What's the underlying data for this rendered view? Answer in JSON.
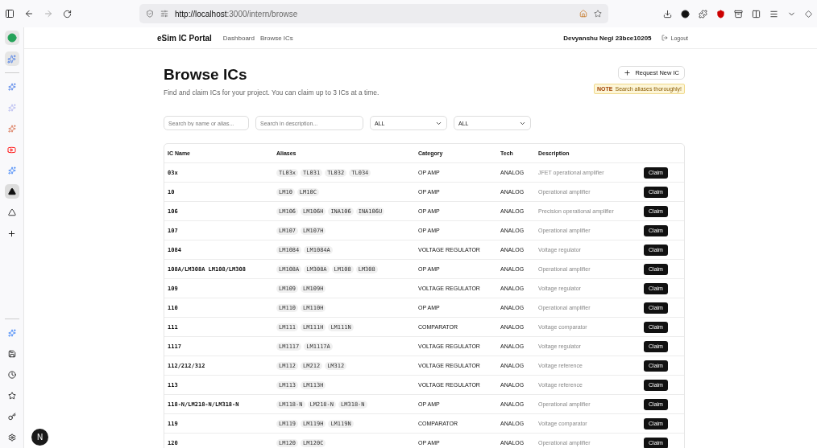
{
  "browser": {
    "url_host": "http://localhost",
    "url_rest": ":3000/intern/browse"
  },
  "nav": {
    "brand": "eSim IC Portal",
    "links": [
      "Dashboard",
      "Browse ICs"
    ],
    "user": "Devyanshu Negi 23bce10205",
    "logout": "Logout"
  },
  "header": {
    "title": "Browse ICs",
    "subtitle": "Find and claim ICs for your project. You can claim up to 3 ICs at a time.",
    "request_button": "Request New IC",
    "note_label": "NOTE",
    "note_text": "Search aliases thoroughly!"
  },
  "filters": {
    "name_search": {
      "placeholder": "Search by name or alias..."
    },
    "description_search": {
      "placeholder": "Search in description..."
    },
    "category_select": "ALL",
    "tech_select": "ALL"
  },
  "table": {
    "columns": [
      "IC Name",
      "Aliases",
      "Category",
      "Tech",
      "Description"
    ],
    "rows": [
      {
        "name": "03x",
        "aliases": [
          "TL03x",
          "TL031",
          "TL032",
          "TL034"
        ],
        "category": "OP AMP",
        "tech": "ANALOG",
        "description": "JFET operational amplifier",
        "action": "Claim"
      },
      {
        "name": "10",
        "aliases": [
          "LM10",
          "LM10C"
        ],
        "category": "OP AMP",
        "tech": "ANALOG",
        "description": "Operational amplifier",
        "action": "Claim"
      },
      {
        "name": "106",
        "aliases": [
          "LM106",
          "LM106H",
          "INA106",
          "INA106U"
        ],
        "category": "OP AMP",
        "tech": "ANALOG",
        "description": "Precision operational amplifier",
        "action": "Claim"
      },
      {
        "name": "107",
        "aliases": [
          "LM107",
          "LM107H"
        ],
        "category": "OP AMP",
        "tech": "ANALOG",
        "description": "Operational amplifier",
        "action": "Claim"
      },
      {
        "name": "1084",
        "aliases": [
          "LM1084",
          "LM1084A"
        ],
        "category": "VOLTAGE REGULATOR",
        "tech": "ANALOG",
        "description": "Voltage regulator",
        "action": "Claim"
      },
      {
        "name": "108A/LM308A LM108/LM308",
        "aliases": [
          "LM108A",
          "LM308A",
          "LM108",
          "LM308"
        ],
        "category": "OP AMP",
        "tech": "ANALOG",
        "description": "Operational amplifier",
        "action": "Claim"
      },
      {
        "name": "109",
        "aliases": [
          "LM109",
          "LM109H"
        ],
        "category": "VOLTAGE REGULATOR",
        "tech": "ANALOG",
        "description": "Voltage regulator",
        "action": "Claim"
      },
      {
        "name": "110",
        "aliases": [
          "LM110",
          "LM110H"
        ],
        "category": "OP AMP",
        "tech": "ANALOG",
        "description": "Operational amplifier",
        "action": "Claim"
      },
      {
        "name": "111",
        "aliases": [
          "LM111",
          "LM111H",
          "LM111N"
        ],
        "category": "COMPARATOR",
        "tech": "ANALOG",
        "description": "Voltage comparator",
        "action": "Claim"
      },
      {
        "name": "1117",
        "aliases": [
          "LM1117",
          "LM1117A"
        ],
        "category": "VOLTAGE REGULATOR",
        "tech": "ANALOG",
        "description": "Voltage regulator",
        "action": "Claim"
      },
      {
        "name": "112/212/312",
        "aliases": [
          "LM112",
          "LM212",
          "LM312"
        ],
        "category": "VOLTAGE REGULATOR",
        "tech": "ANALOG",
        "description": "Voltage reference",
        "action": "Claim"
      },
      {
        "name": "113",
        "aliases": [
          "LM113",
          "LM113H"
        ],
        "category": "VOLTAGE REGULATOR",
        "tech": "ANALOG",
        "description": "Voltage reference",
        "action": "Claim"
      },
      {
        "name": "118-N/LM218-N/LM318-N",
        "aliases": [
          "LM118-N",
          "LM218-N",
          "LM318-N"
        ],
        "category": "OP AMP",
        "tech": "ANALOG",
        "description": "Operational amplifier",
        "action": "Claim"
      },
      {
        "name": "119",
        "aliases": [
          "LM119",
          "LM119H",
          "LM119N"
        ],
        "category": "COMPARATOR",
        "tech": "ANALOG",
        "description": "Voltage comparator",
        "action": "Claim"
      },
      {
        "name": "120",
        "aliases": [
          "LM120",
          "LM120C"
        ],
        "category": "OP AMP",
        "tech": "ANALOG",
        "description": "Operational amplifier",
        "action": "Claim"
      }
    ]
  },
  "dev_badge": "N"
}
